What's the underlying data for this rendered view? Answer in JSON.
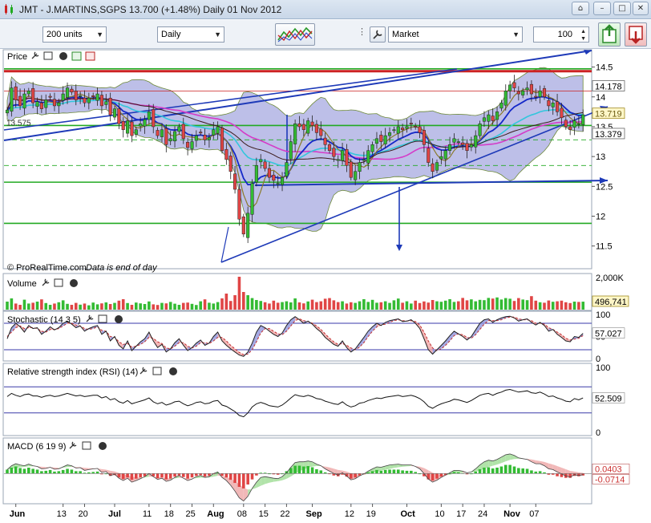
{
  "window": {
    "title": "JMT - J.MARTINS,SGPS    13.700 (+1.48%)    Daily  01 Nov 2012"
  },
  "toolbar": {
    "units_value": "200 units",
    "period_value": "Daily",
    "order_type_value": "Market",
    "quantity_value": "100"
  },
  "colors": {
    "up": "#33bb33",
    "down": "#e04545",
    "band": "#a7a9e0",
    "ma_cyan": "#33c6dc",
    "ma_magenta": "#d43cc8",
    "ma_blue": "#1428c8",
    "ma_olive": "#8a7a2a",
    "line_blue": "#1e3ab8",
    "level_green": "#22aa22",
    "level_red": "#cc2222"
  },
  "chart_data": [
    {
      "name": "price",
      "type": "candlestick",
      "panel_title": "Price",
      "y_ticks": [
        14.5,
        14,
        13.5,
        13,
        12.5,
        12,
        11.5
      ],
      "ylim": [
        11.2,
        14.75
      ],
      "price_labels": [
        {
          "text": "14.178",
          "value": 14.178,
          "style": "plain"
        },
        {
          "text": "13.719",
          "value": 13.719,
          "style": "olive"
        },
        {
          "text": "13.379",
          "value": 13.379,
          "style": "plain"
        }
      ],
      "left_label": {
        "text": "13.575",
        "value": 13.575
      },
      "watermark": "© ProRealTime.com",
      "note": "Data is end of day",
      "horizontal_levels": [
        {
          "value": 14.43,
          "color": "red"
        },
        {
          "value": 14.47,
          "color": "green"
        },
        {
          "value": 14.1,
          "color": "red-thin"
        },
        {
          "value": 13.52,
          "color": "green"
        },
        {
          "value": 13.28,
          "color": "green-dash"
        },
        {
          "value": 12.85,
          "color": "green-dash"
        },
        {
          "value": 12.57,
          "color": "green"
        },
        {
          "value": 11.88,
          "color": "green"
        }
      ],
      "closes": [
        13.78,
        14.15,
        13.95,
        13.85,
        14.05,
        14.1,
        13.9,
        13.92,
        13.8,
        13.95,
        14.0,
        13.85,
        13.9,
        14.05,
        14.15,
        14.08,
        13.95,
        14.02,
        13.9,
        13.98,
        14.0,
        14.05,
        13.85,
        13.92,
        13.7,
        13.8,
        13.55,
        13.45,
        13.6,
        13.35,
        13.45,
        13.55,
        13.62,
        13.75,
        13.5,
        13.35,
        13.45,
        13.2,
        13.3,
        13.42,
        13.5,
        13.3,
        13.15,
        13.25,
        13.35,
        13.4,
        13.28,
        13.32,
        13.45,
        13.5,
        13.1,
        12.95,
        12.75,
        12.45,
        11.95,
        11.7,
        12.05,
        12.55,
        12.85,
        12.95,
        12.8,
        12.65,
        12.6,
        12.55,
        12.65,
        12.9,
        13.25,
        13.55,
        13.5,
        13.45,
        13.6,
        13.52,
        13.4,
        13.35,
        13.2,
        13.1,
        13.0,
        12.95,
        13.1,
        12.85,
        12.65,
        12.75,
        12.9,
        12.95,
        13.1,
        13.2,
        13.3,
        13.25,
        13.35,
        13.4,
        13.45,
        13.5,
        13.45,
        13.5,
        13.55,
        13.5,
        13.4,
        13.2,
        12.9,
        12.75,
        12.9,
        13.0,
        13.1,
        13.2,
        13.3,
        13.25,
        13.2,
        13.1,
        13.2,
        13.35,
        13.55,
        13.65,
        13.7,
        13.6,
        13.75,
        13.9,
        14.1,
        14.2,
        14.15,
        14.05,
        14.1,
        14.15,
        14.05,
        14.0,
        14.1,
        14.0,
        13.85,
        13.9,
        13.75,
        13.65,
        13.5,
        13.45,
        13.6,
        13.55,
        13.7
      ]
    },
    {
      "name": "volume",
      "type": "bar",
      "panel_title": "Volume",
      "y_ticks_labels": [
        "2,000K"
      ],
      "last_value_label": "496,741",
      "ylim": [
        0,
        2100
      ],
      "values": [
        500,
        700,
        380,
        300,
        620,
        380,
        430,
        500,
        640,
        410,
        300,
        380,
        460,
        580,
        360,
        300,
        420,
        310,
        380,
        270,
        440,
        330,
        390,
        450,
        350,
        420,
        560,
        650,
        410,
        300,
        440,
        390,
        350,
        510,
        330,
        290,
        420,
        390,
        480,
        370,
        300,
        420,
        440,
        360,
        290,
        520,
        640,
        430,
        380,
        470,
        700,
        1000,
        540,
        900,
        2050,
        1100,
        900,
        720,
        600,
        540,
        460,
        380,
        560,
        430,
        470,
        520,
        450,
        700,
        450,
        390,
        510,
        620,
        470,
        520,
        680,
        720,
        580,
        470,
        520,
        380,
        460,
        420,
        520,
        650,
        480,
        610,
        430,
        460,
        520,
        420,
        580,
        690,
        430,
        520,
        380,
        560,
        410,
        510,
        440,
        600,
        520,
        490,
        560,
        650,
        480,
        520,
        730,
        580,
        640,
        520,
        610,
        590,
        730,
        690,
        760,
        630,
        720,
        680,
        540,
        720,
        630,
        590,
        840,
        560,
        460,
        430,
        570,
        490,
        520,
        560,
        460,
        410,
        500,
        480,
        497
      ],
      "up_flags": [
        1,
        1,
        0,
        0,
        1,
        1,
        0,
        1,
        0,
        1,
        1,
        0,
        1,
        1,
        1,
        0,
        0,
        1,
        0,
        1,
        1,
        1,
        0,
        1,
        0,
        1,
        0,
        0,
        1,
        0,
        1,
        1,
        1,
        1,
        0,
        0,
        1,
        0,
        1,
        1,
        1,
        0,
        0,
        1,
        1,
        1,
        0,
        1,
        1,
        1,
        0,
        0,
        0,
        0,
        0,
        0,
        1,
        1,
        1,
        1,
        0,
        0,
        0,
        0,
        1,
        1,
        1,
        1,
        0,
        0,
        1,
        0,
        0,
        0,
        0,
        0,
        0,
        0,
        1,
        0,
        0,
        1,
        1,
        1,
        1,
        1,
        1,
        0,
        1,
        1,
        1,
        1,
        0,
        1,
        1,
        0,
        0,
        0,
        0,
        0,
        1,
        1,
        1,
        1,
        1,
        0,
        0,
        0,
        1,
        1,
        1,
        1,
        1,
        0,
        1,
        1,
        1,
        1,
        0,
        0,
        1,
        1,
        0,
        0,
        1,
        0,
        0,
        1,
        0,
        0,
        0,
        0,
        1,
        0,
        1
      ]
    },
    {
      "name": "stochastic",
      "type": "line",
      "panel_title": "Stochastic (14 3 5)",
      "y_ticks": [
        100,
        50,
        0
      ],
      "ylim": [
        0,
        100
      ],
      "levels": [
        80,
        20
      ],
      "last_value_label": "57.027",
      "k_values": [
        45,
        70,
        80,
        72,
        60,
        75,
        68,
        70,
        55,
        62,
        72,
        65,
        70,
        80,
        85,
        78,
        70,
        74,
        62,
        68,
        72,
        75,
        55,
        62,
        40,
        50,
        30,
        22,
        40,
        18,
        28,
        38,
        45,
        60,
        40,
        25,
        32,
        15,
        22,
        36,
        45,
        30,
        18,
        25,
        35,
        42,
        30,
        35,
        50,
        60,
        40,
        30,
        22,
        15,
        8,
        5,
        15,
        35,
        60,
        75,
        70,
        62,
        55,
        50,
        58,
        75,
        88,
        95,
        88,
        80,
        85,
        78,
        68,
        60,
        48,
        40,
        32,
        28,
        40,
        25,
        15,
        22,
        35,
        48,
        62,
        72,
        80,
        75,
        82,
        86,
        88,
        90,
        84,
        85,
        88,
        80,
        68,
        45,
        20,
        10,
        20,
        30,
        40,
        52,
        62,
        56,
        50,
        42,
        50,
        65,
        80,
        88,
        90,
        82,
        88,
        92,
        95,
        96,
        92,
        85,
        88,
        90,
        82,
        76,
        82,
        75,
        62,
        66,
        55,
        48,
        40,
        38,
        50,
        48,
        57
      ],
      "d_values": [
        50,
        60,
        70,
        74,
        68,
        70,
        70,
        68,
        62,
        60,
        66,
        66,
        68,
        74,
        80,
        80,
        76,
        74,
        68,
        66,
        68,
        72,
        64,
        62,
        50,
        48,
        38,
        32,
        34,
        26,
        28,
        32,
        38,
        48,
        46,
        38,
        34,
        24,
        22,
        28,
        36,
        36,
        28,
        24,
        28,
        36,
        36,
        34,
        40,
        48,
        48,
        40,
        30,
        22,
        14,
        9,
        10,
        20,
        38,
        58,
        68,
        68,
        62,
        56,
        54,
        62,
        74,
        86,
        90,
        86,
        84,
        80,
        74,
        66,
        56,
        46,
        38,
        32,
        34,
        30,
        24,
        20,
        26,
        36,
        50,
        62,
        72,
        76,
        78,
        82,
        86,
        88,
        86,
        85,
        86,
        84,
        76,
        60,
        40,
        24,
        18,
        22,
        30,
        40,
        52,
        56,
        54,
        48,
        46,
        54,
        66,
        78,
        86,
        86,
        86,
        88,
        92,
        94,
        94,
        90,
        88,
        88,
        86,
        80,
        80,
        78,
        70,
        66,
        60,
        54,
        46,
        42,
        44,
        46,
        52
      ]
    },
    {
      "name": "rsi",
      "type": "line",
      "panel_title": "Relative strength index (RSI) (14)",
      "y_ticks": [
        100,
        50,
        0
      ],
      "ylim": [
        0,
        100
      ],
      "levels": [
        70,
        30
      ],
      "last_value_label": "52.509",
      "values": [
        55,
        60,
        57,
        55,
        58,
        59,
        56,
        56,
        54,
        56,
        57,
        55,
        56,
        58,
        60,
        58,
        56,
        57,
        55,
        56,
        57,
        57,
        53,
        55,
        50,
        52,
        47,
        45,
        49,
        44,
        46,
        48,
        50,
        53,
        47,
        44,
        46,
        42,
        44,
        47,
        48,
        44,
        41,
        43,
        46,
        47,
        44,
        45,
        48,
        49,
        42,
        40,
        36,
        32,
        26,
        24,
        30,
        39,
        44,
        46,
        44,
        41,
        40,
        39,
        42,
        47,
        53,
        58,
        56,
        55,
        57,
        55,
        52,
        51,
        48,
        46,
        44,
        43,
        47,
        42,
        39,
        41,
        45,
        46,
        49,
        51,
        53,
        52,
        54,
        55,
        56,
        57,
        55,
        56,
        57,
        55,
        52,
        47,
        40,
        37,
        41,
        44,
        46,
        48,
        51,
        50,
        48,
        46,
        49,
        53,
        57,
        59,
        60,
        57,
        60,
        62,
        65,
        66,
        64,
        62,
        63,
        64,
        61,
        60,
        62,
        59,
        55,
        56,
        53,
        51,
        48,
        47,
        52,
        50,
        53
      ]
    },
    {
      "name": "macd",
      "type": "bar",
      "panel_title": "MACD (6 19 9)",
      "ylim": [
        -0.75,
        0.6
      ],
      "value_labels": [
        {
          "text": "0.0403",
          "value": 0.04,
          "color": "#cc3333"
        },
        {
          "text": "-0.0714",
          "value": -0.07,
          "color": "#cc3333"
        }
      ],
      "histogram": [
        0.1,
        0.15,
        0.18,
        0.14,
        0.12,
        0.15,
        0.12,
        0.1,
        0.06,
        0.07,
        0.09,
        0.05,
        0.06,
        0.09,
        0.12,
        0.1,
        0.06,
        0.06,
        0.02,
        0.03,
        0.04,
        0.05,
        -0.02,
        0.0,
        -0.06,
        -0.04,
        -0.1,
        -0.14,
        -0.1,
        -0.16,
        -0.13,
        -0.1,
        -0.07,
        -0.02,
        -0.07,
        -0.12,
        -0.1,
        -0.15,
        -0.13,
        -0.08,
        -0.05,
        -0.09,
        -0.13,
        -0.1,
        -0.06,
        -0.04,
        -0.08,
        -0.06,
        -0.01,
        0.02,
        -0.06,
        -0.1,
        -0.16,
        -0.24,
        -0.34,
        -0.38,
        -0.28,
        -0.15,
        -0.05,
        0.02,
        0.02,
        0.0,
        -0.02,
        -0.03,
        0.0,
        0.06,
        0.14,
        0.2,
        0.2,
        0.18,
        0.19,
        0.16,
        0.11,
        0.08,
        0.03,
        -0.01,
        -0.05,
        -0.07,
        -0.03,
        -0.08,
        -0.13,
        -0.1,
        -0.05,
        -0.02,
        0.03,
        0.06,
        0.09,
        0.07,
        0.09,
        0.1,
        0.1,
        0.1,
        0.08,
        0.07,
        0.07,
        0.04,
        0.0,
        -0.07,
        -0.15,
        -0.18,
        -0.13,
        -0.08,
        -0.04,
        0.0,
        0.04,
        0.03,
        0.01,
        -0.02,
        0.0,
        0.05,
        0.11,
        0.15,
        0.16,
        0.13,
        0.15,
        0.18,
        0.22,
        0.22,
        0.18,
        0.14,
        0.13,
        0.12,
        0.08,
        0.05,
        0.06,
        0.03,
        -0.03,
        -0.03,
        -0.07,
        -0.09,
        -0.11,
        -0.11,
        -0.06,
        -0.07,
        -0.05
      ],
      "macd_line": [
        0.1,
        0.2,
        0.25,
        0.22,
        0.2,
        0.24,
        0.2,
        0.18,
        0.12,
        0.13,
        0.16,
        0.11,
        0.12,
        0.17,
        0.22,
        0.2,
        0.14,
        0.15,
        0.08,
        0.1,
        0.12,
        0.13,
        0.03,
        0.05,
        -0.05,
        -0.02,
        -0.12,
        -0.18,
        -0.12,
        -0.22,
        -0.18,
        -0.13,
        -0.08,
        0.0,
        -0.08,
        -0.15,
        -0.12,
        -0.2,
        -0.17,
        -0.1,
        -0.05,
        -0.12,
        -0.18,
        -0.14,
        -0.08,
        -0.05,
        -0.1,
        -0.08,
        0.0,
        0.04,
        -0.1,
        -0.18,
        -0.3,
        -0.45,
        -0.62,
        -0.7,
        -0.58,
        -0.38,
        -0.22,
        -0.1,
        -0.08,
        -0.1,
        -0.12,
        -0.13,
        -0.08,
        0.02,
        0.16,
        0.28,
        0.3,
        0.3,
        0.32,
        0.3,
        0.24,
        0.2,
        0.12,
        0.06,
        0.0,
        -0.04,
        0.02,
        -0.06,
        -0.16,
        -0.13,
        -0.06,
        -0.01,
        0.06,
        0.12,
        0.17,
        0.16,
        0.19,
        0.22,
        0.23,
        0.24,
        0.22,
        0.22,
        0.22,
        0.18,
        0.12,
        0.0,
        -0.14,
        -0.22,
        -0.17,
        -0.1,
        -0.04,
        0.02,
        0.08,
        0.08,
        0.06,
        0.02,
        0.04,
        0.12,
        0.22,
        0.3,
        0.34,
        0.32,
        0.36,
        0.42,
        0.48,
        0.5,
        0.46,
        0.4,
        0.38,
        0.36,
        0.3,
        0.25,
        0.25,
        0.2,
        0.12,
        0.1,
        0.04,
        -0.01,
        -0.06,
        -0.09,
        -0.03,
        -0.05,
        -0.03
      ]
    }
  ],
  "x_axis": {
    "tick_labels": [
      {
        "text": "Jun",
        "i": 2,
        "bold": true
      },
      {
        "text": "13",
        "i": 13
      },
      {
        "text": "20",
        "i": 18
      },
      {
        "text": "Jul",
        "i": 25,
        "bold": true
      },
      {
        "text": "11",
        "i": 33
      },
      {
        "text": "18",
        "i": 38
      },
      {
        "text": "25",
        "i": 43
      },
      {
        "text": "Aug",
        "i": 48,
        "bold": true
      },
      {
        "text": "08",
        "i": 55
      },
      {
        "text": "15",
        "i": 60
      },
      {
        "text": "22",
        "i": 65
      },
      {
        "text": "Sep",
        "i": 71,
        "bold": true
      },
      {
        "text": "12",
        "i": 80
      },
      {
        "text": "19",
        "i": 85
      },
      {
        "text": "Oct",
        "i": 93,
        "bold": true
      },
      {
        "text": "10",
        "i": 101
      },
      {
        "text": "17",
        "i": 106
      },
      {
        "text": "24",
        "i": 111
      },
      {
        "text": "Nov",
        "i": 117,
        "bold": true
      },
      {
        "text": "07",
        "i": 123
      }
    ]
  }
}
